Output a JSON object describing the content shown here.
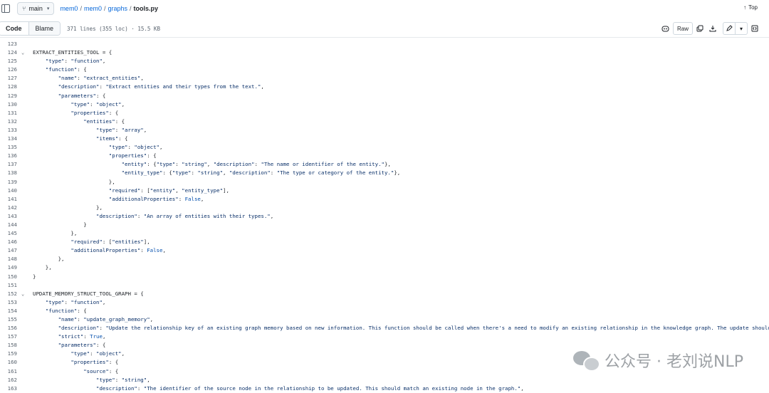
{
  "header": {
    "branch": "main",
    "breadcrumb": [
      "mem0",
      "mem0",
      "graphs"
    ],
    "file_name": "tools.py",
    "top_label": "Top"
  },
  "toolbar": {
    "code_tab": "Code",
    "blame_tab": "Blame",
    "meta": "371 lines (355 loc) · 15.5 KB",
    "raw_label": "Raw"
  },
  "code_lines": [
    {
      "n": "123",
      "h": ""
    },
    {
      "n": "124",
      "fold": true,
      "h": "EXTRACT_ENTITIES_TOOL = {"
    },
    {
      "n": "125",
      "h": "    <span class=\"s\">\"type\"</span>: <span class=\"s\">\"function\"</span>,"
    },
    {
      "n": "126",
      "h": "    <span class=\"s\">\"function\"</span>: {"
    },
    {
      "n": "127",
      "h": "        <span class=\"s\">\"name\"</span>: <span class=\"s\">\"extract_entities\"</span>,"
    },
    {
      "n": "128",
      "h": "        <span class=\"s\">\"description\"</span>: <span class=\"s\">\"Extract entities and their types from the text.\"</span>,"
    },
    {
      "n": "129",
      "h": "        <span class=\"s\">\"parameters\"</span>: {"
    },
    {
      "n": "130",
      "h": "            <span class=\"s\">\"type\"</span>: <span class=\"s\">\"object\"</span>,"
    },
    {
      "n": "131",
      "h": "            <span class=\"s\">\"properties\"</span>: {"
    },
    {
      "n": "132",
      "h": "                <span class=\"s\">\"entities\"</span>: {"
    },
    {
      "n": "133",
      "h": "                    <span class=\"s\">\"type\"</span>: <span class=\"s\">\"array\"</span>,"
    },
    {
      "n": "134",
      "h": "                    <span class=\"s\">\"items\"</span>: {"
    },
    {
      "n": "135",
      "h": "                        <span class=\"s\">\"type\"</span>: <span class=\"s\">\"object\"</span>,"
    },
    {
      "n": "136",
      "h": "                        <span class=\"s\">\"properties\"</span>: {"
    },
    {
      "n": "137",
      "h": "                            <span class=\"s\">\"entity\"</span>: {<span class=\"s\">\"type\"</span>: <span class=\"s\">\"string\"</span>, <span class=\"s\">\"description\"</span>: <span class=\"s\">\"The name or identifier of the entity.\"</span>},"
    },
    {
      "n": "138",
      "h": "                            <span class=\"s\">\"entity_type\"</span>: {<span class=\"s\">\"type\"</span>: <span class=\"s\">\"string\"</span>, <span class=\"s\">\"description\"</span>: <span class=\"s\">\"The type or category of the entity.\"</span>},"
    },
    {
      "n": "139",
      "h": "                        },"
    },
    {
      "n": "140",
      "h": "                        <span class=\"s\">\"required\"</span>: [<span class=\"s\">\"entity\"</span>, <span class=\"s\">\"entity_type\"</span>],"
    },
    {
      "n": "141",
      "h": "                        <span class=\"s\">\"additionalProperties\"</span>: <span class=\"k\">False</span>,"
    },
    {
      "n": "142",
      "h": "                    },"
    },
    {
      "n": "143",
      "h": "                    <span class=\"s\">\"description\"</span>: <span class=\"s\">\"An array of entities with their types.\"</span>,"
    },
    {
      "n": "144",
      "h": "                }"
    },
    {
      "n": "145",
      "h": "            },"
    },
    {
      "n": "146",
      "h": "            <span class=\"s\">\"required\"</span>: [<span class=\"s\">\"entities\"</span>],"
    },
    {
      "n": "147",
      "h": "            <span class=\"s\">\"additionalProperties\"</span>: <span class=\"k\">False</span>,"
    },
    {
      "n": "148",
      "h": "        },"
    },
    {
      "n": "149",
      "h": "    },"
    },
    {
      "n": "150",
      "h": "}"
    },
    {
      "n": "151",
      "h": ""
    },
    {
      "n": "152",
      "fold": true,
      "h": "UPDATE_MEMORY_STRUCT_TOOL_GRAPH = {"
    },
    {
      "n": "153",
      "h": "    <span class=\"s\">\"type\"</span>: <span class=\"s\">\"function\"</span>,"
    },
    {
      "n": "154",
      "h": "    <span class=\"s\">\"function\"</span>: {"
    },
    {
      "n": "155",
      "h": "        <span class=\"s\">\"name\"</span>: <span class=\"s\">\"update_graph_memory\"</span>,"
    },
    {
      "n": "156",
      "h": "        <span class=\"s\">\"description\"</span>: <span class=\"s\">\"Update the relationship key of an existing graph memory based on new information. This function should be called when there's a need to modify an existing relationship in the knowledge graph. The update should o</span>"
    },
    {
      "n": "157",
      "h": "        <span class=\"s\">\"strict\"</span>: <span class=\"k\">True</span>,"
    },
    {
      "n": "158",
      "h": "        <span class=\"s\">\"parameters\"</span>: {"
    },
    {
      "n": "159",
      "h": "            <span class=\"s\">\"type\"</span>: <span class=\"s\">\"object\"</span>,"
    },
    {
      "n": "160",
      "h": "            <span class=\"s\">\"properties\"</span>: {"
    },
    {
      "n": "161",
      "h": "                <span class=\"s\">\"source\"</span>: {"
    },
    {
      "n": "162",
      "h": "                    <span class=\"s\">\"type\"</span>: <span class=\"s\">\"string\"</span>,"
    },
    {
      "n": "163",
      "h": "                    <span class=\"s\">\"description\"</span>: <span class=\"s\">\"The identifier of the source node in the relationship to be updated. This should match an existing node in the graph.\"</span>,"
    }
  ],
  "watermark": {
    "text": "公众号 · 老刘说NLP"
  },
  "icons": {
    "branch": "git-branch-icon",
    "top": "arrow-up-icon",
    "copilot": "copilot-icon",
    "copy": "copy-icon",
    "download": "download-icon",
    "edit": "pencil-icon",
    "symbols": "symbols-panel-icon"
  }
}
